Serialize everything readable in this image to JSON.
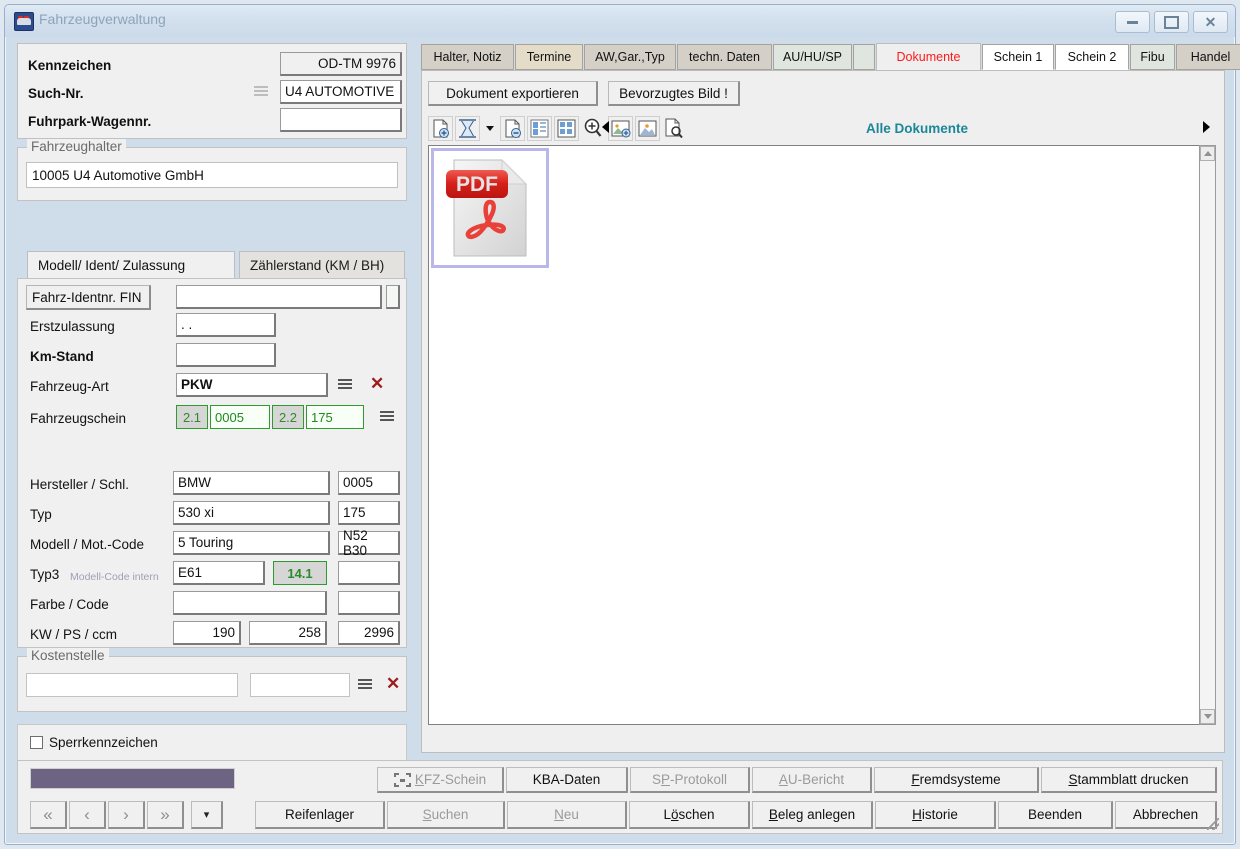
{
  "window": {
    "title": "Fahrzeugverwaltung",
    "icon": "vehicle-icon",
    "controls": {
      "minimize": "minimize",
      "maximize": "maximize",
      "close": "close"
    }
  },
  "header": {
    "fields": [
      {
        "label": "Kennzeichen",
        "value": "OD-TM 9976"
      },
      {
        "label": "Such-Nr.",
        "value": "U4 AUTOMOTIVE"
      },
      {
        "label": "Fuhrpark-Wagennr.",
        "value": ""
      }
    ]
  },
  "holder": {
    "legend": "Fahrzeughalter",
    "value": "10005 U4 Automotive GmbH"
  },
  "left_tabs": [
    {
      "label": "Modell/ Ident/ Zulassung",
      "active": true
    },
    {
      "label": "Zählerstand (KM / BH)",
      "active": false
    }
  ],
  "vehicle": {
    "fin_label": "Fahrz-Identnr. FIN",
    "fin_value": "",
    "erstzulassung_label": "Erstzulassung",
    "erstzulassung_value": ". .",
    "kmstand_label": "Km-Stand",
    "kmstand_value": "",
    "fahrzeugart_label": "Fahrzeug-Art",
    "fahrzeugart_value": "PKW",
    "fahrzeugschein_label": "Fahrzeugschein",
    "fahrzeugschein": [
      {
        "code": "2.1",
        "value": "0005"
      },
      {
        "code": "2.2",
        "value": "175"
      }
    ],
    "rows": [
      {
        "label": "Hersteller / Schl.",
        "v1": "BMW",
        "v2": "0005"
      },
      {
        "label": "Typ",
        "v1": "530 xi",
        "v2": "175"
      },
      {
        "label": "Modell / Mot.-Code",
        "v1": "5 Touring",
        "v2": "N52 B30"
      }
    ],
    "typ3_label": "Typ3",
    "typ3_hint": "Modell-Code intern",
    "typ3_value": "E61",
    "typ3_code": "14.1",
    "typ3_extra": "",
    "farbe_label": "Farbe / Code",
    "farbe_value": "",
    "farbe_code": "",
    "kwps_label": "KW / PS / ccm",
    "kw": "190",
    "ps": "258",
    "ccm": "2996"
  },
  "kostenstelle": {
    "legend": "Kostenstelle",
    "value1": "",
    "value2": ""
  },
  "sperr": {
    "label": "Sperrkennzeichen",
    "checked": false
  },
  "tabs": [
    {
      "label": "Halter, Notiz",
      "style": "grey"
    },
    {
      "label": "Termine",
      "style": "beige"
    },
    {
      "label": "AW,Gar.,Typ",
      "style": "grey"
    },
    {
      "label": "techn. Daten",
      "style": "grey"
    },
    {
      "label": "AU/HU/SP",
      "style": "greenish"
    },
    {
      "label": "",
      "style": "blank"
    },
    {
      "label": "Dokumente",
      "style": "active"
    },
    {
      "label": "Schein 1",
      "style": "white"
    },
    {
      "label": "Schein 2",
      "style": "white"
    },
    {
      "label": "Fibu",
      "style": "greenish"
    },
    {
      "label": "Handel",
      "style": "grey"
    }
  ],
  "doc_toolbar": {
    "export_button": "Dokument exportieren",
    "favorite_button": "Bevorzugtes Bild !",
    "filter_label": "Alle Dokumente",
    "icons": [
      "document-add-icon",
      "scan-icon",
      "dropdown-arrow-icon",
      "document-remove-icon",
      "list-view-icon",
      "tile-view-icon",
      "zoom-in-icon",
      "image-add-icon",
      "image-icon",
      "document-preview-icon"
    ]
  },
  "documents": [
    {
      "name": "pdf-document-thumbnail",
      "type": "PDF",
      "selected": true
    }
  ],
  "bottom": {
    "row1": [
      {
        "label": "KFZ-Schein",
        "accel": "K",
        "disabled": true,
        "icon": "scan-frame-icon"
      },
      {
        "label": "KBA-Daten",
        "accel": "",
        "disabled": false
      },
      {
        "label": "SP-Protokoll",
        "accel": "P",
        "disabled": true
      },
      {
        "label": "AU-Bericht",
        "accel": "A",
        "disabled": true
      },
      {
        "label": "Fremdsysteme",
        "accel": "F",
        "disabled": false
      },
      {
        "label": "Stammblatt drucken",
        "accel": "S",
        "disabled": false
      }
    ],
    "row2": [
      {
        "label": "Reifenlager",
        "accel": "",
        "disabled": false
      },
      {
        "label": "Suchen",
        "accel": "S",
        "disabled": true
      },
      {
        "label": "Neu",
        "accel": "N",
        "disabled": true
      },
      {
        "label": "Löschen",
        "accel": "ö",
        "disabled": false
      },
      {
        "label": "Beleg anlegen",
        "accel": "B",
        "disabled": false
      },
      {
        "label": "Historie",
        "accel": "H",
        "disabled": false
      },
      {
        "label": "Beenden",
        "accel": "",
        "disabled": false
      },
      {
        "label": "Abbrechen",
        "accel": "",
        "disabled": false
      }
    ],
    "nav": [
      "«",
      "‹",
      "›",
      "»",
      "▾"
    ]
  },
  "annotation": {
    "type": "red-arrow",
    "points_to": "Dokumente",
    "color": "#ff0000"
  },
  "colors": {
    "accent_red": "#ff1a1a",
    "filter_teal": "#1b8799",
    "progress_purple": "#6d6383",
    "green_field": "#2e9b2e"
  }
}
